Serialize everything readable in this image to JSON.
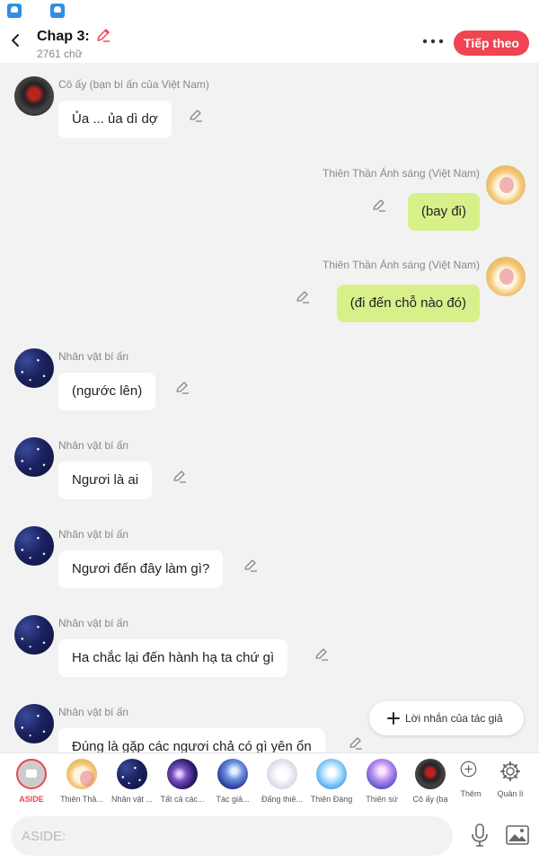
{
  "header": {
    "title": "Chap 3:",
    "word_count": "2761 chữ",
    "next_button": "Tiếp theo"
  },
  "messages": [
    {
      "side": "left",
      "name": "Cô ấy (bạn bí ấn của Việt Nam)",
      "text": "Ủa ... ủa dì dợ",
      "avatar": "dark"
    },
    {
      "side": "right",
      "name": "Thiên Thần Ánh sáng (Việt Nam)",
      "text": "(bay đi)",
      "avatar": "angel"
    },
    {
      "side": "right",
      "name": "Thiên Thần Ánh sáng (Việt Nam)",
      "text": "(đi đến chỗ nào đó)",
      "avatar": "angel"
    },
    {
      "side": "left",
      "name": "Nhân vật bí ấn",
      "text": "(ngước lên)",
      "avatar": "night"
    },
    {
      "side": "left",
      "name": "Nhân vật bí ấn",
      "text": "Ngươi là ai",
      "avatar": "night"
    },
    {
      "side": "left",
      "name": "Nhân vật bí ấn",
      "text": "Ngươi đến đây làm gì?",
      "avatar": "night"
    },
    {
      "side": "left",
      "name": "Nhân vật bí ấn",
      "text": "Ha chắc lại đến hành hạ ta chứ gì",
      "avatar": "night"
    },
    {
      "side": "left",
      "name": "Nhân vật bí ấn",
      "text": "Đúng là gặp các ngươi chả có gì yên ổn",
      "avatar": "night"
    }
  ],
  "author_message_button": "Lời nhắn của tác giả",
  "characters": [
    {
      "label": "ASIDE",
      "avatar": "aside"
    },
    {
      "label": "Thiên Thầ...",
      "avatar": "angel"
    },
    {
      "label": "Nhân vật ...",
      "avatar": "night"
    },
    {
      "label": "Tất cả các...",
      "avatar": "galaxy"
    },
    {
      "label": "Tác giả...",
      "avatar": "blue"
    },
    {
      "label": "Đấng thiê...",
      "avatar": "white"
    },
    {
      "label": "Thiên Đàng",
      "avatar": "sky"
    },
    {
      "label": "Thiên sứ",
      "avatar": "angelic"
    },
    {
      "label": "Cô ấy (bạ",
      "avatar": "dark"
    }
  ],
  "actions": {
    "more": "Thêm",
    "manage": "Quản lí"
  },
  "input": {
    "placeholder": "ASIDE:"
  },
  "colors": {
    "accent": "#f04452",
    "bubble_right": "#d8f08a",
    "bubble_left": "#ffffff",
    "background": "#f2f2f2"
  },
  "icons": [
    "app-icon",
    "back-icon",
    "pencil-icon",
    "more-icon",
    "plus-icon",
    "plus-circle-icon",
    "gear-icon",
    "mic-icon",
    "image-icon"
  ]
}
